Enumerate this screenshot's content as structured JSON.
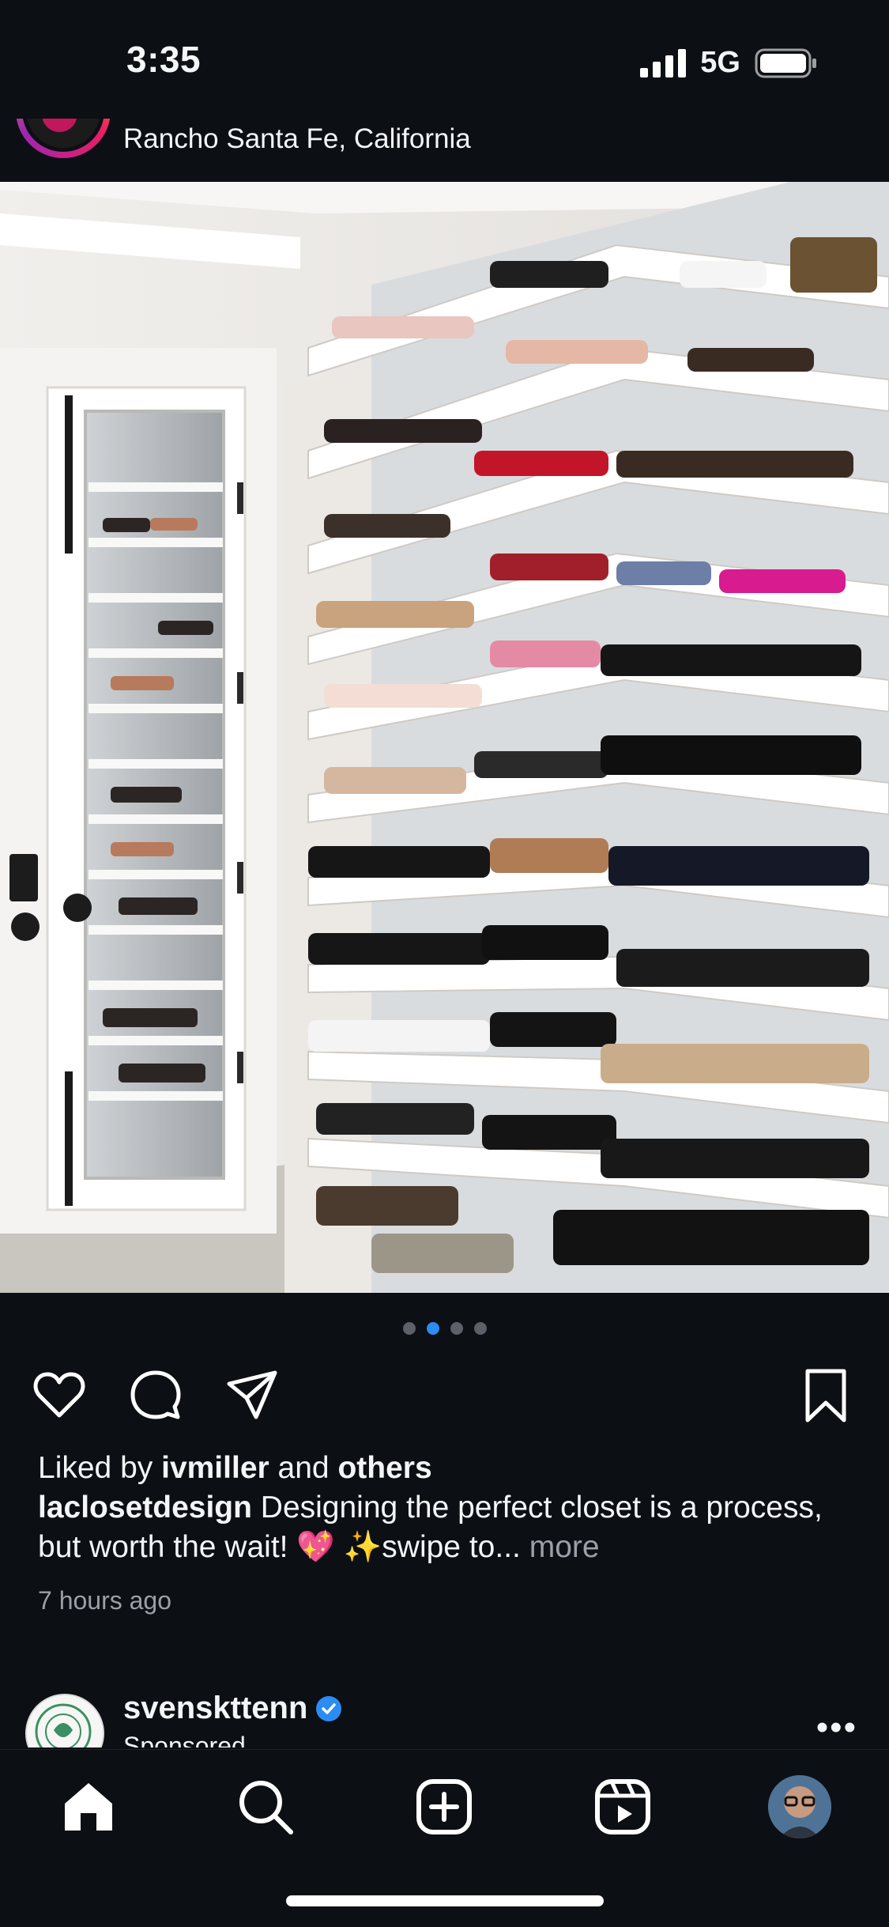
{
  "status": {
    "time": "3:35",
    "network": "5G"
  },
  "post": {
    "location": "Rancho Santa Fe, California",
    "carousel": {
      "count": 4,
      "active_index": 1
    },
    "liked_by_prefix": "Liked by",
    "liked_by_user": "ivmiller",
    "liked_by_join": "and",
    "liked_by_others": "others",
    "author": "laclosetdesign",
    "caption": "Designing the perfect closet is a process, but worth the wait! 💖 ✨swipe to...",
    "more_label": "more",
    "time_ago": "7 hours ago"
  },
  "next_post": {
    "username": "svenskttenn",
    "verified": true,
    "label": "Sponsored"
  },
  "icons": {
    "signal": "signal-icon",
    "battery": "battery-icon",
    "like": "heart-icon",
    "comment": "comment-icon",
    "share": "send-icon",
    "save": "bookmark-icon",
    "home": "home-icon",
    "search": "search-icon",
    "create": "plus-square-icon",
    "reels": "reels-icon",
    "profile": "profile-avatar"
  },
  "colors": {
    "background": "#0c0f14",
    "accent_blue": "#2b8cf4",
    "muted_text": "#9aa0a8"
  }
}
